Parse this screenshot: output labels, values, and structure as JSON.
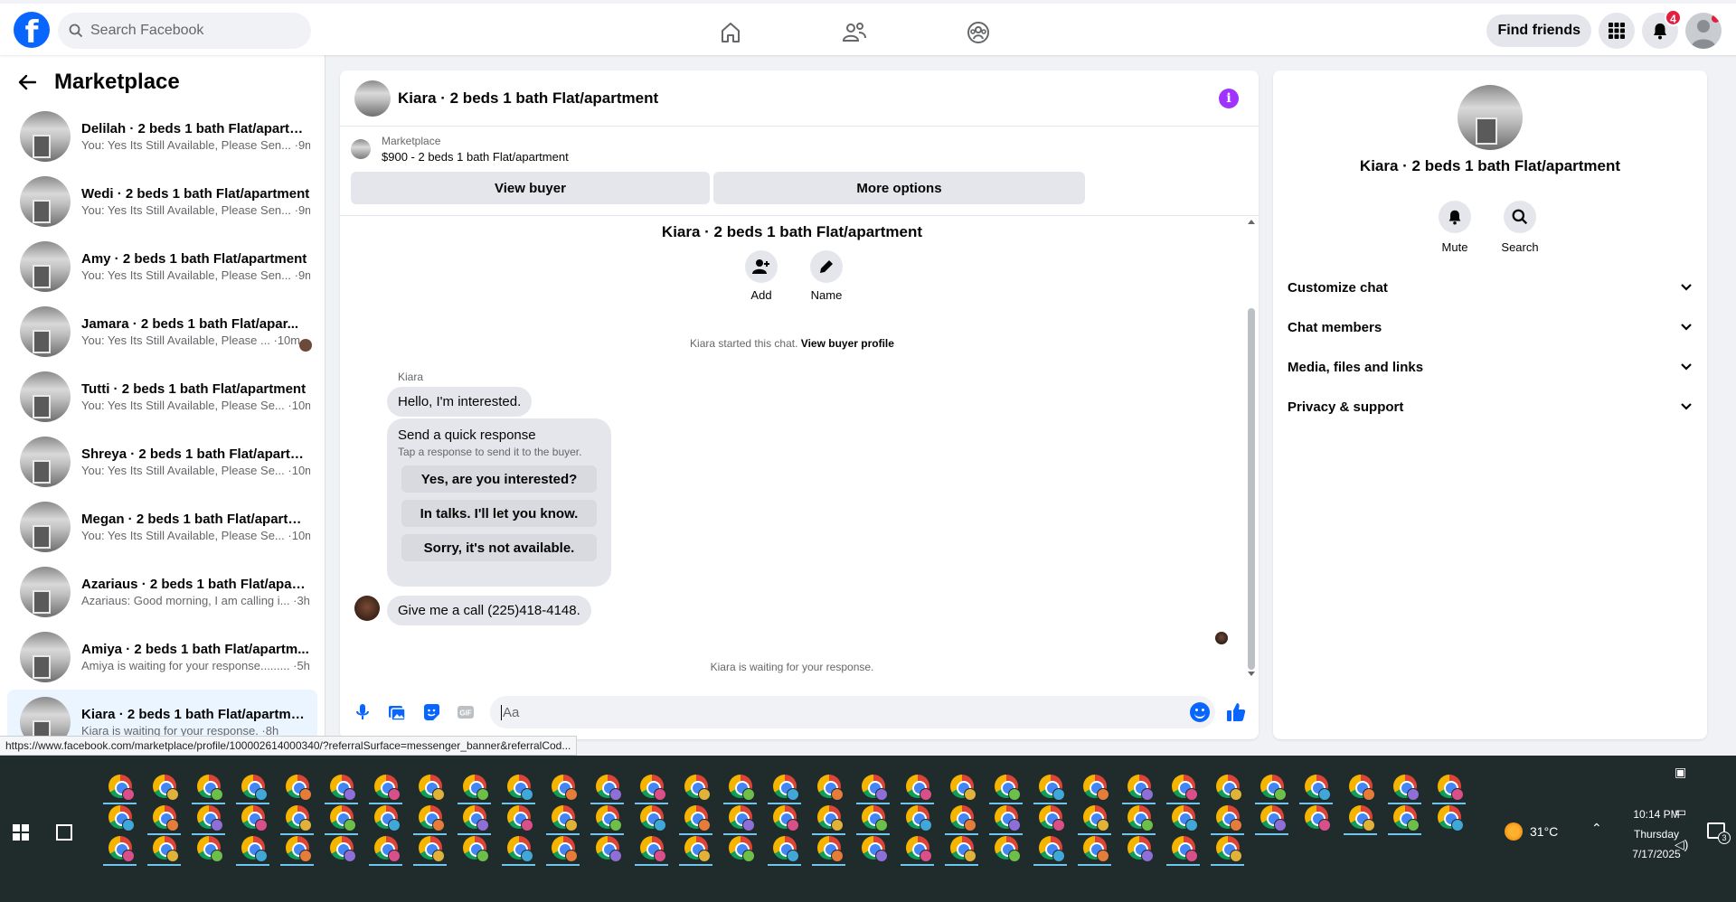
{
  "topnav": {
    "search_placeholder": "Search Facebook",
    "find_friends": "Find friends",
    "notification_count": "4",
    "logo_letter": "f"
  },
  "sidebar": {
    "title": "Marketplace",
    "conversations": [
      {
        "name": "Delilah · 2 beds 1 bath Flat/apartm...",
        "preview": "You: Yes Its Still Available, Please Sen...",
        "time": "9m"
      },
      {
        "name": "Wedi · 2 beds 1 bath Flat/apartment",
        "preview": "You: Yes Its Still Available, Please Sen...",
        "time": "9m"
      },
      {
        "name": "Amy · 2 beds 1 bath Flat/apartment",
        "preview": "You: Yes Its Still Available, Please Sen...",
        "time": "9m"
      },
      {
        "name": "Jamara · 2 beds 1 bath Flat/apar...",
        "preview": "You: Yes Its Still Available, Please ...",
        "time": "10m"
      },
      {
        "name": "Tutti · 2 beds 1 bath Flat/apartment",
        "preview": "You: Yes Its Still Available, Please Se...",
        "time": "10m"
      },
      {
        "name": "Shreya · 2 beds 1 bath Flat/apartm...",
        "preview": "You: Yes Its Still Available, Please Se...",
        "time": "10m"
      },
      {
        "name": "Megan · 2 beds 1 bath Flat/apartm...",
        "preview": "You: Yes Its Still Available, Please Se...",
        "time": "10m"
      },
      {
        "name": "Azariaus · 2 beds 1 bath Flat/apart...",
        "preview": "Azariaus: Good morning, I am calling i...",
        "time": "3h"
      },
      {
        "name": "Amiya · 2 beds 1 bath Flat/apartm...",
        "preview": "Amiya is waiting for your response.........",
        "time": "5h"
      },
      {
        "name": "Kiara · 2 beds 1 bath Flat/apartment",
        "preview": "Kiara is waiting for your response.",
        "time": "8h"
      }
    ]
  },
  "chat": {
    "title": "Kiara · 2 beds 1 bath Flat/apartment",
    "marketplace_label": "Marketplace",
    "listing": "$900 - 2 beds 1 bath Flat/apartment",
    "view_buyer": "View buyer",
    "more_options": "More options",
    "intro_title": "Kiara · 2 beds 1 bath Flat/apartment",
    "add_label": "Add",
    "name_label": "Name",
    "started_text": "Kiara started this chat.",
    "view_buyer_profile": "View buyer profile",
    "sender_name": "Kiara",
    "message_1": "Hello, I'm interested.",
    "quick_title": "Send a quick response",
    "quick_sub": "Tap a response to send it to the buyer.",
    "quick_options": [
      "Yes, are you interested?",
      "In talks. I'll let you know.",
      "Sorry, it's not available."
    ],
    "message_2": "Give me a call (225)418-4148.",
    "waiting": "Kiara is waiting for your response.",
    "composer_placeholder": "Aa"
  },
  "rpanel": {
    "name": "Kiara · 2 beds 1 bath Flat/apartment",
    "mute": "Mute",
    "search": "Search",
    "sections": [
      "Customize chat",
      "Chat members",
      "Media, files and links",
      "Privacy & support"
    ]
  },
  "statusbar": {
    "url": "https://www.facebook.com/marketplace/profile/100002614000340/?referralSurface=messenger_banner&referralCod..."
  },
  "taskbar": {
    "temperature": "31°C",
    "time": "10:14 PM",
    "day": "Thursday",
    "date": "7/17/2025",
    "notification_count": "3"
  },
  "colors": {
    "brand": "#0866ff",
    "info": "#a033ff",
    "badge": "#e41e3f",
    "taskbar": "#202b2b"
  }
}
